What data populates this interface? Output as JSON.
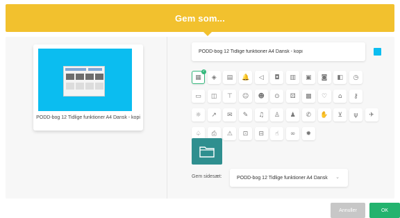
{
  "header": {
    "title": "Gem som..."
  },
  "preview": {
    "caption": "PODD-bog 12 Tidlige funktioner A4 Dansk - kopi"
  },
  "name_field": {
    "value": "PODD-bog 12 Tidlige funktioner A4 Dansk - kopi",
    "color": "#0bbdf0"
  },
  "icons": [
    {
      "name": "grid-book-icon",
      "glyph": "▦",
      "selected": true
    },
    {
      "name": "cube-icon",
      "glyph": "◈"
    },
    {
      "name": "document-icon",
      "glyph": "▤"
    },
    {
      "name": "bell-icon",
      "glyph": "🔔"
    },
    {
      "name": "megaphone-icon",
      "glyph": "◁"
    },
    {
      "name": "bag-icon",
      "glyph": "◘"
    },
    {
      "name": "calculator-icon",
      "glyph": "▥"
    },
    {
      "name": "calendar-icon",
      "glyph": "▣"
    },
    {
      "name": "camera-icon",
      "glyph": "◙"
    },
    {
      "name": "chat-icon",
      "glyph": "◧"
    },
    {
      "name": "clock-icon",
      "glyph": "◷"
    },
    {
      "name": "empty-slot",
      "glyph": ""
    },
    {
      "name": "screen-icon",
      "glyph": "▭"
    },
    {
      "name": "copy-icon",
      "glyph": "◫"
    },
    {
      "name": "signpost-icon",
      "glyph": "⊤"
    },
    {
      "name": "smiley-icon",
      "glyph": "☺"
    },
    {
      "name": "face-icon",
      "glyph": "☻"
    },
    {
      "name": "gamepad-icon",
      "glyph": "⊙"
    },
    {
      "name": "dice-icon",
      "glyph": "⚄"
    },
    {
      "name": "gift-icon",
      "glyph": "▩"
    },
    {
      "name": "heart-icon",
      "glyph": "♡"
    },
    {
      "name": "home-icon",
      "glyph": "⌂"
    },
    {
      "name": "key-icon",
      "glyph": "⚷"
    },
    {
      "name": "empty-slot",
      "glyph": ""
    },
    {
      "name": "lightbulb-icon",
      "glyph": "☼"
    },
    {
      "name": "pin-icon",
      "glyph": "↗"
    },
    {
      "name": "mail-icon",
      "glyph": "✉"
    },
    {
      "name": "pencil-icon",
      "glyph": "✎"
    },
    {
      "name": "music-icon",
      "glyph": "♫"
    },
    {
      "name": "person-icon",
      "glyph": "♙"
    },
    {
      "name": "people-icon",
      "glyph": "♟"
    },
    {
      "name": "phone-icon",
      "glyph": "✆"
    },
    {
      "name": "hand-icon",
      "glyph": "✋"
    },
    {
      "name": "cart-icon",
      "glyph": "⊻"
    },
    {
      "name": "fork-icon",
      "glyph": "ψ"
    },
    {
      "name": "airplane-icon",
      "glyph": "✈"
    },
    {
      "name": "balloon-icon",
      "glyph": "♤"
    },
    {
      "name": "printer-icon",
      "glyph": "⎙"
    },
    {
      "name": "warning-icon",
      "glyph": "⚠"
    },
    {
      "name": "car-icon",
      "glyph": "⊡"
    },
    {
      "name": "truck-icon",
      "glyph": "⊟"
    },
    {
      "name": "thumbs-up-icon",
      "glyph": "☝"
    },
    {
      "name": "glasses-icon",
      "glyph": "∞"
    },
    {
      "name": "sun-icon",
      "glyph": "✹"
    }
  ],
  "folder_preview": {
    "color": "#2f8f8f"
  },
  "pageset": {
    "label": "Gem sidesæt:",
    "selected": "PODD-bog 12 Tidlige funktioner A4 Dansk"
  },
  "buttons": {
    "cancel": "Annuller",
    "ok": "OK"
  }
}
